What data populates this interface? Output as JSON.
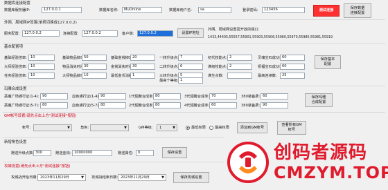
{
  "db": {
    "server_ip_label": "数据库服务器IP:",
    "server_ip_value": "127.0.0.1",
    "db_name_label": "数据库名称:",
    "db_name_value": "MuOnline",
    "user_label": "数据库用户名:",
    "user_value": "sa",
    "password_label": "登录密码:",
    "password_value": "123456",
    "test_button": "测试连接",
    "save_button": "保存数据\n连接配置",
    "section_title": "数据库连接配置"
  },
  "ext": {
    "section_title": "外网、局域网IP设置(单机切换成127.0.0.2)",
    "server_cfg_label": "服务配置:",
    "server_cfg_value": "127.0.0.2",
    "connect_cfg_label": "连接配置:",
    "connect_cfg_value": "127.0.0.2",
    "client_label": "客户端:",
    "client_value": "127.0.0.2",
    "set_ip_button": "设置IP地址",
    "ports_title": "外网、局域网设置需开放的端口:",
    "ports_value": "1433,44405,55557,55901,55903,55906,55960,55970,55980,55981,55919"
  },
  "basic": {
    "section_title": "基本配置项",
    "labels": [
      "基础经验倍率:",
      "大师经验倍率:",
      "任务经验倍率:",
      "基础物品掉率:",
      "物品消失时间:",
      "大师物品掉率:",
      "基础金钱掉率:",
      "金钱消失时间:",
      "一转升级点:",
      "二转升级点:",
      "三转升级点:",
      "四转升级点:",
      "初代技能点:",
      "满级技能点:",
      "满生点数:",
      "最高召回上限:",
      "最高连续数:"
    ],
    "r1": [
      {
        "label": "基础经验倍率:",
        "value": "10"
      },
      {
        "label": "基础物品掉率:",
        "value": "50"
      },
      {
        "label": "基础金钱掉率:",
        "value": "20"
      },
      {
        "label": "一转升级点:",
        "value": "7"
      },
      {
        "label": "初代技能点:",
        "value": "2"
      },
      {
        "label": "灵魂宝石成功率:",
        "value": "60"
      }
    ],
    "r2": [
      {
        "label": "大师经验倍率:",
        "value": "10"
      },
      {
        "label": "物品消失时间:",
        "value": "30"
      },
      {
        "label": "金钱消失时间:",
        "value": "30"
      },
      {
        "label": "二转升级点:",
        "value": "6"
      },
      {
        "label": "满级技能点:",
        "value": "2"
      },
      {
        "label": "祝福宝石成功率:",
        "value": "60"
      }
    ],
    "r3": [
      {
        "label": "任务经验倍率:",
        "value": "10"
      },
      {
        "label": "大师物品掉率:",
        "value": "10"
      },
      {
        "label": "最低金币消耗:",
        "value": "1"
      },
      {
        "label": "三转升级点:",
        "value": "5"
      },
      {
        "label": "满生点数:",
        "value": ""
      },
      {
        "label": "最高连续数:",
        "value": "25"
      }
    ],
    "r4": [
      {
        "label": "最高个等级:",
        "value": "1"
      }
    ],
    "save_button": "保存基本\n配置"
  },
  "wash": {
    "section_title": "玛雅合成设置",
    "r1": [
      {
        "label": "恶魔广场通行证(1-4):",
        "value": "90"
      },
      {
        "label": "血色通行证(1-4):",
        "value": "90"
      },
      {
        "label": "1代翅膀合成率:",
        "value": "80"
      },
      {
        "label": "3代翅膀合成率:",
        "value": "70"
      },
      {
        "label": "380装备费:",
        "value": "60"
      }
    ],
    "r2": [
      {
        "label": "恶魔广场通行证(5-7):",
        "value": "80"
      },
      {
        "label": "血色通行证(5-7):",
        "value": "80"
      },
      {
        "label": "2代翅膀合成率:",
        "value": "80"
      },
      {
        "label": "4代翅膀合成率:",
        "value": "60"
      },
      {
        "label": "380装备费:",
        "value": "90"
      }
    ],
    "save_button": "保存玛雅\n合成配置"
  },
  "gm": {
    "section_title_black": "GM帐号设置",
    "section_title_red": "(请先点击上方\"测试连接\"按钮)",
    "account_label": "帐号:",
    "role_label": "角色:",
    "gm_level_label": "GM等级:",
    "gm_level_value": "1",
    "radio_low": "最低权限",
    "radio_high": "最高权限",
    "add_button": "添加到GM帐号",
    "view_button": "查看所有GM\n帐号"
  },
  "role_gift": {
    "section_title": "新增角色设置",
    "level_label": "赠送升级点数:",
    "level_value": "300",
    "money_label": "赠送金钱:",
    "money_value": "10000000",
    "extra_label": "赠送属性:",
    "extra_value": "0",
    "save_button": "保存设置"
  },
  "castle": {
    "section_title_black": "攻城设置",
    "section_title_red": "(请先点击上方\"测试连接\"按钮)",
    "start_label": "攻城战开始日期:",
    "start_value": "2023年11月29日",
    "end_label": "攻城战结束日期:",
    "end_value": "2023年11月29日",
    "save_button": "保存攻城设置"
  },
  "watermark": {
    "line1": "创码者源码",
    "line2": "CMZYM.TOP"
  },
  "colors": {
    "accent_red": "#d0021b",
    "button_red": "#ff3030",
    "selection_blue": "#1e6fd9",
    "watermark_red": "#e01b2e"
  }
}
